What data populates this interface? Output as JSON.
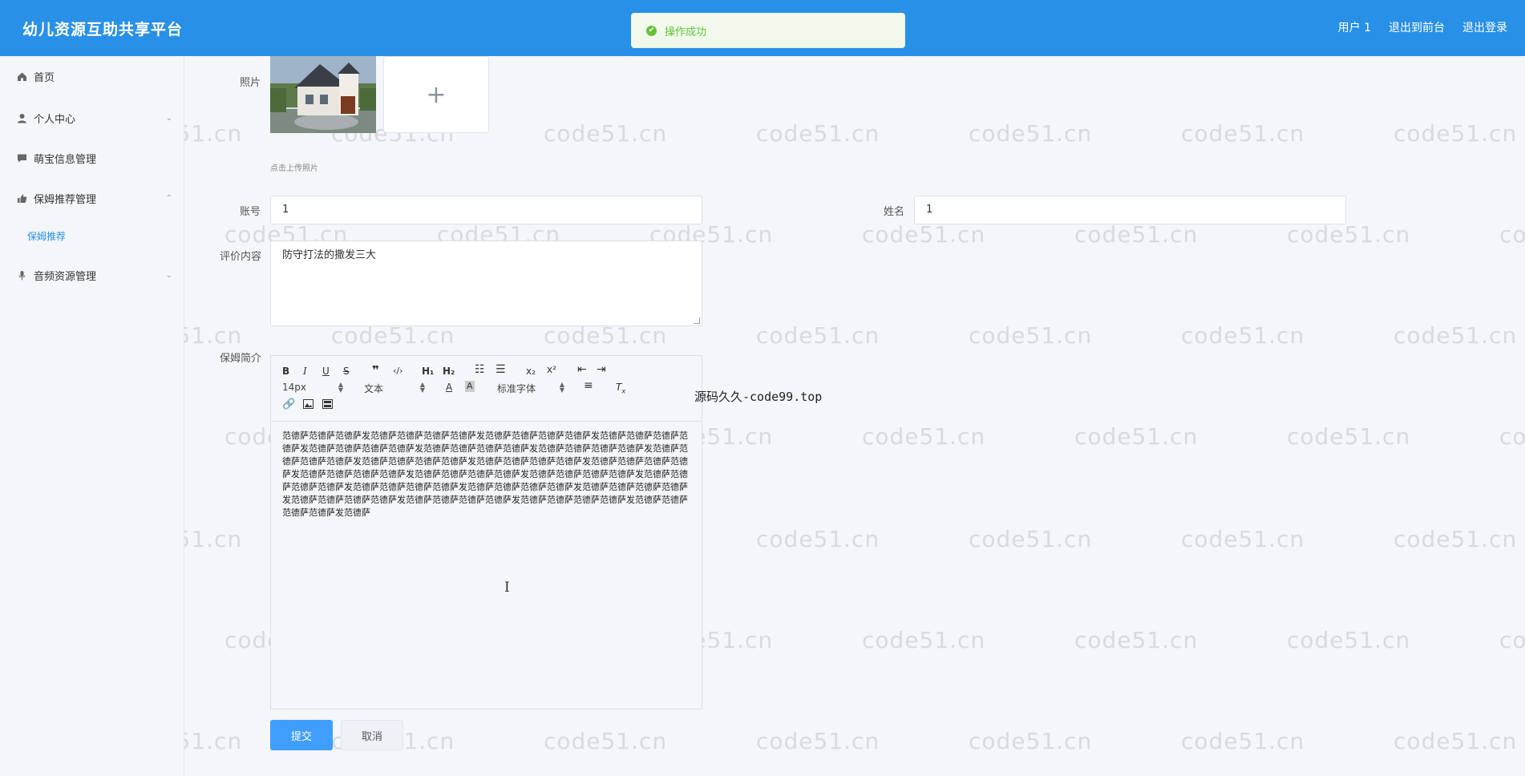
{
  "header": {
    "brand": "幼儿资源互助共享平台",
    "user": "用户 1",
    "back_to_front": "退出到前台",
    "logout": "退出登录"
  },
  "toast": {
    "text": "操作成功",
    "icon": "check-circle-icon",
    "color": "#67c23a"
  },
  "sidebar": {
    "items": [
      {
        "label": "首页",
        "icon": "home-icon"
      },
      {
        "label": "个人中心",
        "icon": "user-icon"
      },
      {
        "label": "萌宝信息管理",
        "icon": "chat-icon"
      },
      {
        "label": "保姆推荐管理",
        "icon": "like-icon"
      },
      {
        "label": "音频资源管理",
        "icon": "mic-icon"
      }
    ],
    "sub_active": "保姆推荐"
  },
  "form": {
    "photo_label": "照片",
    "upload_hint": "点击上传照片",
    "account_label": "账号",
    "account_value": "1",
    "name_label": "姓名",
    "name_value": "1",
    "review_label": "评价内容",
    "review_value": "防守打法的撒发三大",
    "intro_label": "保姆简介",
    "font_size": "14px",
    "text_type": "文本",
    "font_family": "标准字体",
    "intro_content": "范德萨范德萨范德萨发范德萨范德萨范德萨范德萨发范德萨范德萨范德萨范德萨发范德萨范德萨范德萨范德萨发范德萨范德萨范德萨范德萨发范德萨范德萨范德萨范德萨发范德萨范德萨范德萨范德萨发范德萨范德萨范德萨范德萨发范德萨范德萨范德萨范德萨发范德萨范德萨范德萨范德萨发范德萨范德萨范德萨范德萨发范德萨范德萨范德萨范德萨发范德萨范德萨范德萨范德萨发范德萨范德萨范德萨范德萨发范德萨范德萨范德萨范德萨发范德萨范德萨范德萨范德萨发范德萨范德萨范德萨范德萨发范德萨范德萨范德萨范德萨发范德萨范德萨范德萨范德萨发范德萨范德萨范德萨范德萨发范德萨范德萨范德萨范德萨发范德萨范德萨范德萨范德萨发范德萨",
    "submit": "提交",
    "cancel": "取消"
  },
  "caption": "源码久久-code99.top",
  "watermark": "code51.cn",
  "colors": {
    "primary": "#2990e8",
    "button": "#409eff",
    "background": "#f4f6fa"
  }
}
